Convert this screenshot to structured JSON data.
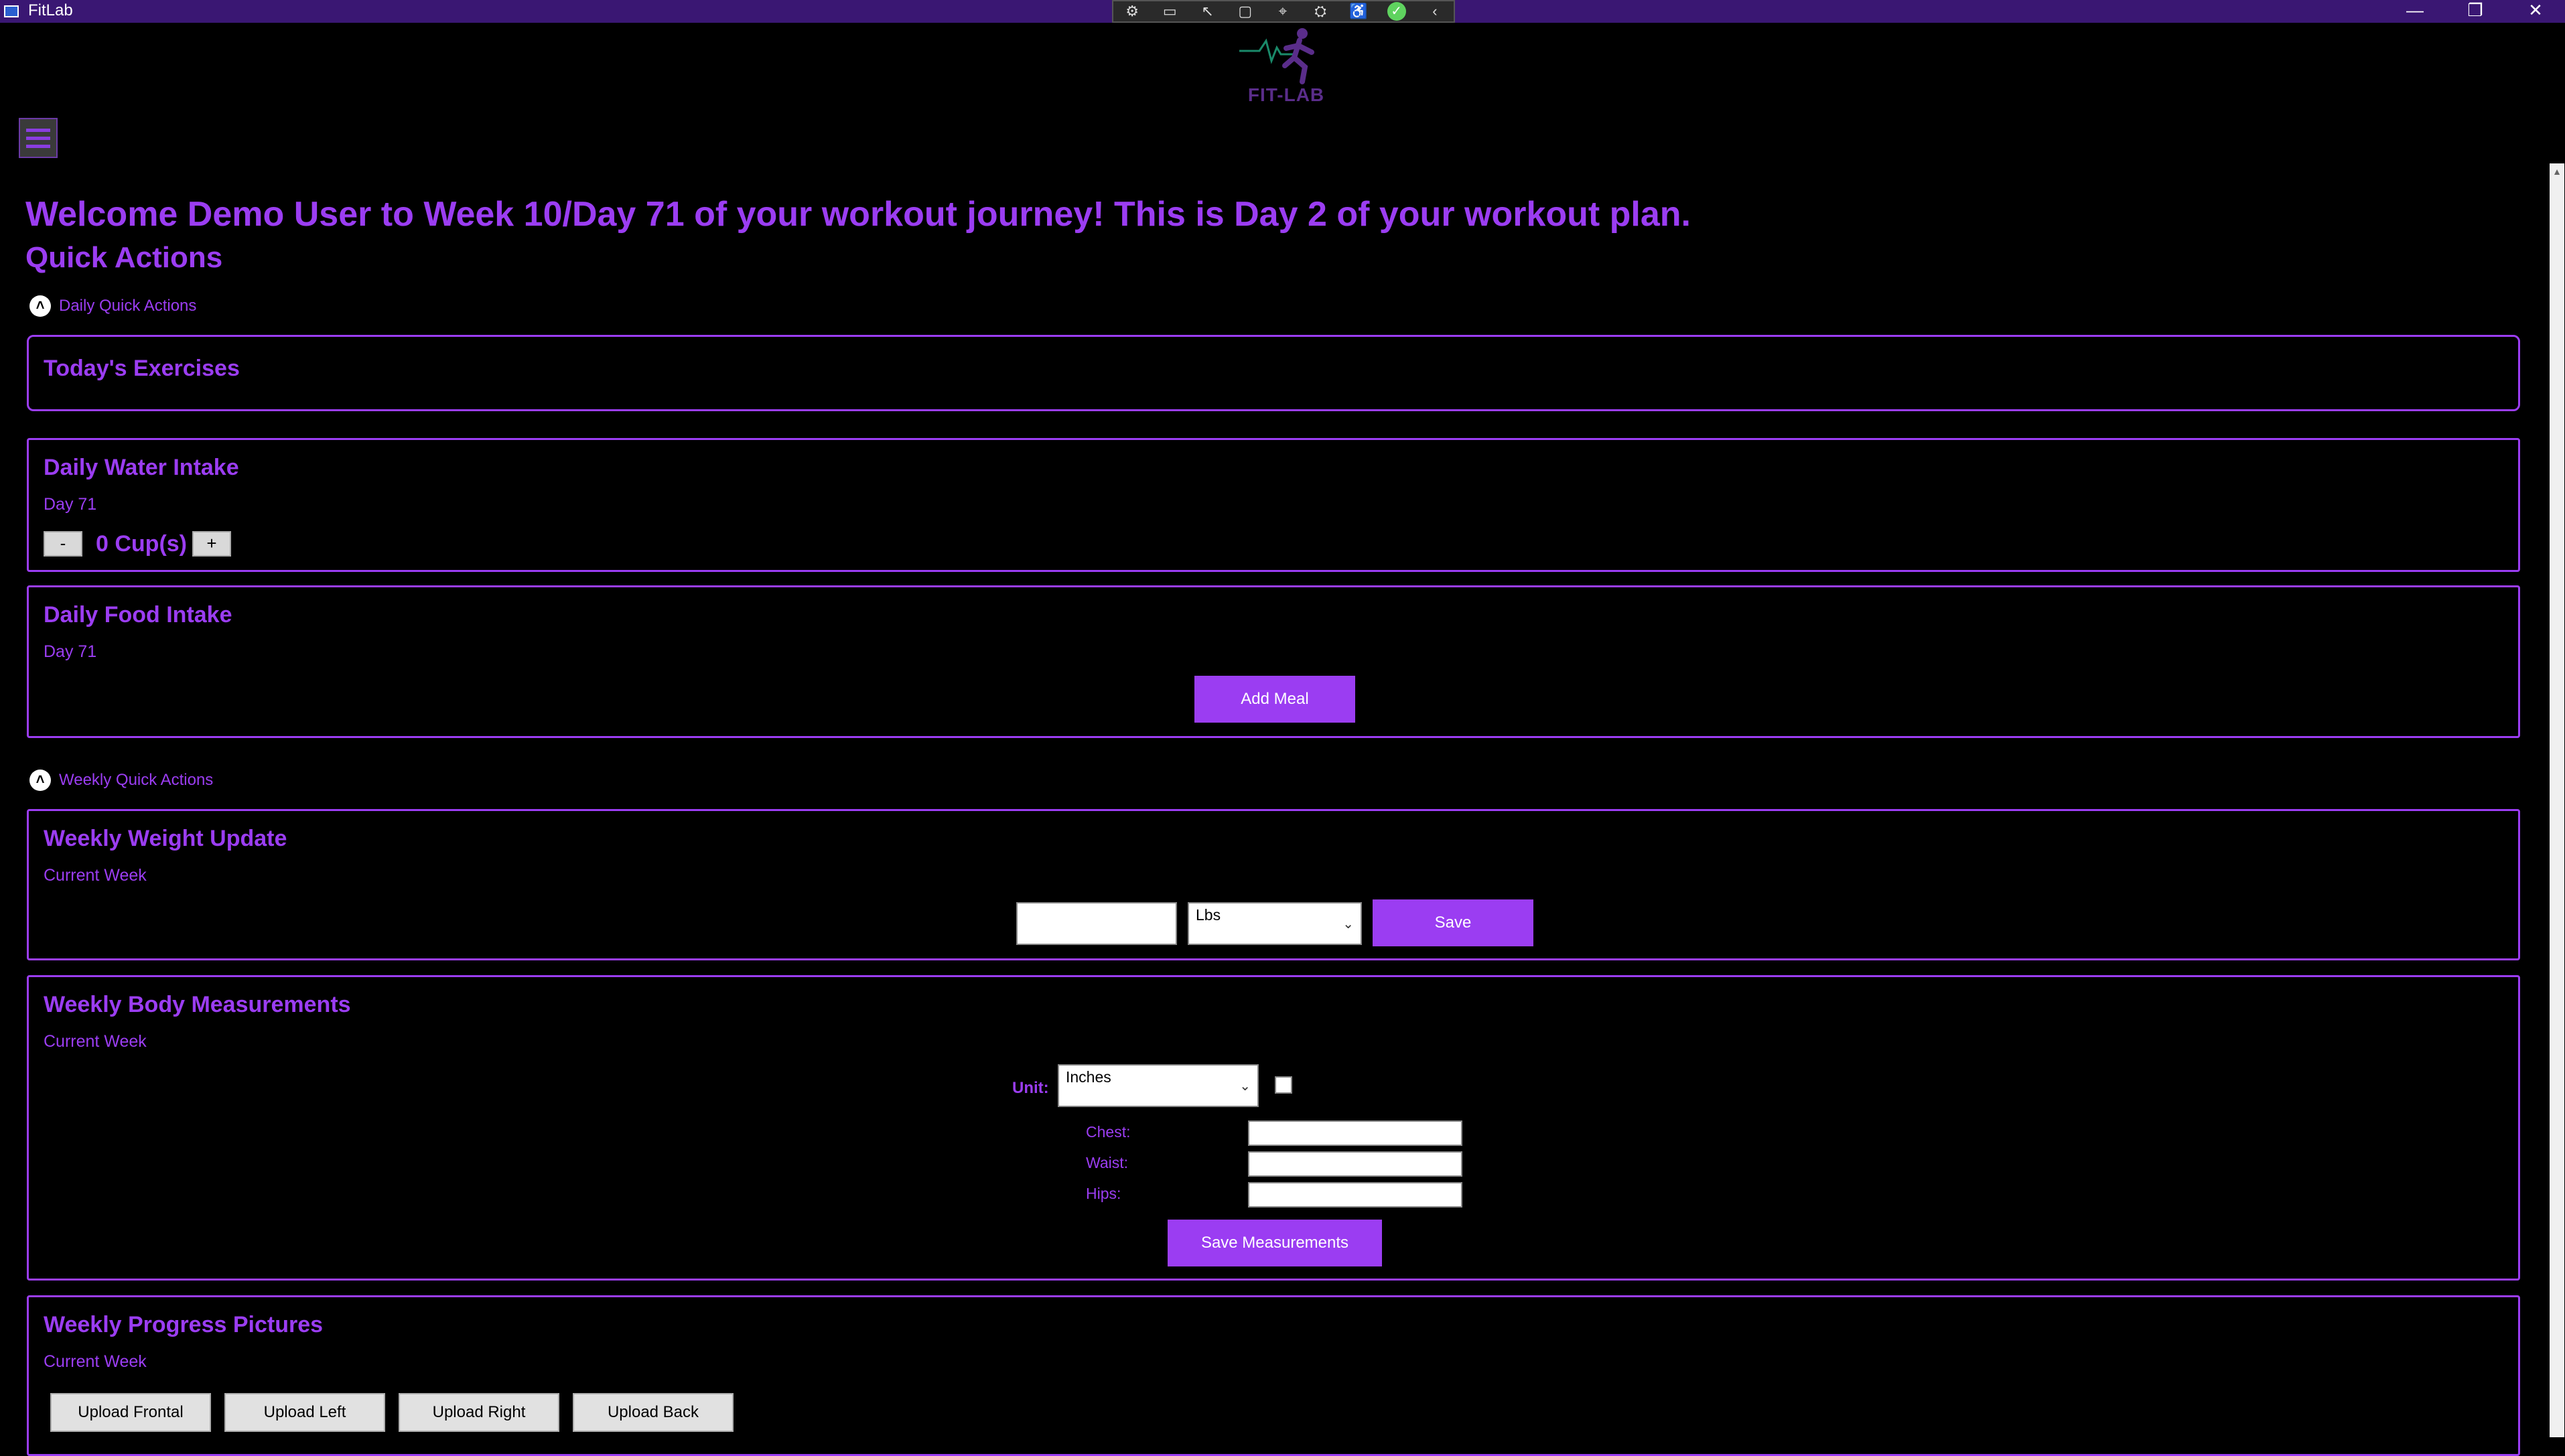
{
  "window": {
    "title": "FitLab",
    "minimize": "—",
    "maximize": "❐",
    "close": "✕"
  },
  "debug_toolbar": {
    "icons": [
      "live-tree-icon",
      "record-icon",
      "select-element-icon",
      "layout-icon",
      "track-focus-icon",
      "binding-icon",
      "accessibility-icon",
      "check-icon",
      "collapse-icon"
    ]
  },
  "logo": {
    "text": "FIT-LAB"
  },
  "header": {
    "welcome": "Welcome Demo User to Week 10/Day 71 of your workout journey! This is Day 2 of your workout plan.",
    "quick_actions": "Quick Actions"
  },
  "daily": {
    "expander_label": "Daily Quick Actions",
    "exercises": {
      "title": "Today's Exercises"
    },
    "water": {
      "title": "Daily Water Intake",
      "day": "Day 71",
      "minus": "-",
      "plus": "+",
      "cups": "0 Cup(s)"
    },
    "food": {
      "title": "Daily Food Intake",
      "day": "Day 71",
      "add_meal": "Add Meal"
    }
  },
  "weekly": {
    "expander_label": "Weekly Quick Actions",
    "weight": {
      "title": "Weekly Weight Update",
      "sub": "Current Week",
      "value": "",
      "unit": "Lbs",
      "save": "Save"
    },
    "measurements": {
      "title": "Weekly Body Measurements",
      "sub": "Current Week",
      "unit_label": "Unit:",
      "unit": "Inches",
      "chest": "Chest:",
      "waist": "Waist:",
      "hips": "Hips:",
      "save": "Save Measurements"
    },
    "pictures": {
      "title": "Weekly Progress Pictures",
      "sub": "Current Week",
      "frontal": "Upload Frontal",
      "left": "Upload Left",
      "right": "Upload Right",
      "back": "Upload Back"
    }
  },
  "colors": {
    "accent": "#9b3df2",
    "titlebar": "#3a1773",
    "background": "#000000"
  }
}
